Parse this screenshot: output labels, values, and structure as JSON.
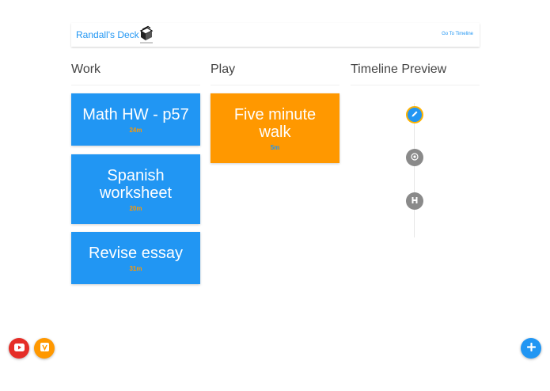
{
  "header": {
    "brand": "Randall's Deck",
    "goto_link": "Go To Timeline",
    "logo_icon": "deck-logo-icon"
  },
  "columns": {
    "work": "Work",
    "play": "Play",
    "timeline": "Timeline Preview"
  },
  "cards": [
    {
      "title": "Math HW - p57",
      "time": "24m",
      "column": "work",
      "color": "#2196f3"
    },
    {
      "title": "Spanish worksheet",
      "time": "20m",
      "column": "work",
      "color": "#2196f3"
    },
    {
      "title": "Revise essay",
      "time": "31m",
      "column": "work",
      "color": "#2196f3"
    },
    {
      "title": "Five minute walk",
      "time": "5m",
      "column": "play",
      "color": "#ff9800"
    }
  ],
  "timeline": [
    {
      "icon": "pencil-icon",
      "active": true
    },
    {
      "icon": "target-icon",
      "active": false
    },
    {
      "icon": "flag-icon",
      "active": false
    }
  ],
  "fabs": {
    "youtube": "youtube-icon",
    "vine": "vine-icon",
    "add": "plus-icon"
  },
  "colors": {
    "accent": "#2196f3",
    "secondary": "#ff9800",
    "youtube": "#e52d27",
    "timeline_inactive": "#8a8a8a"
  }
}
